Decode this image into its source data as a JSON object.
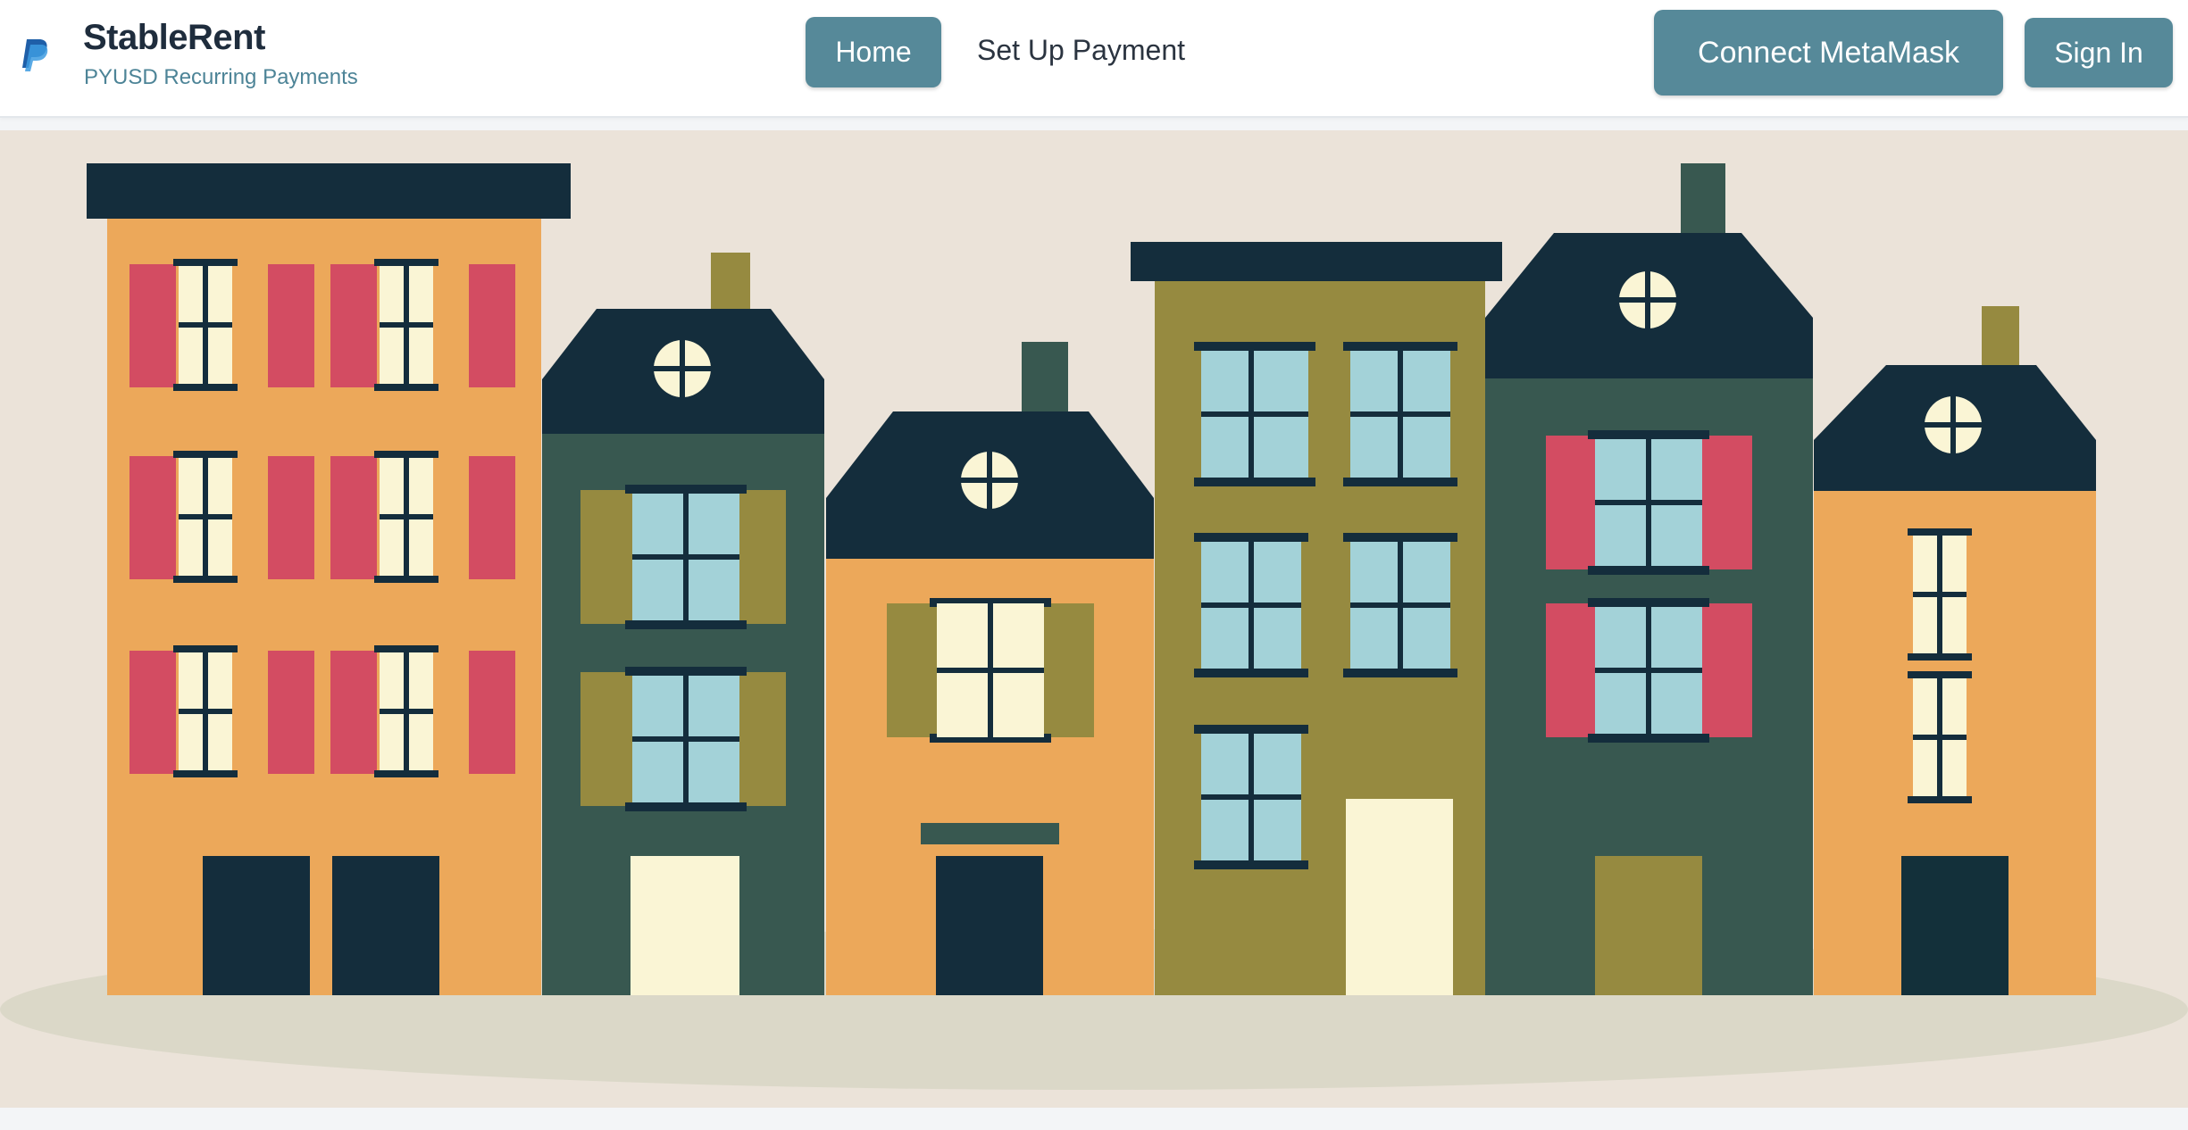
{
  "brand": {
    "title": "StableRent",
    "subtitle": "PYUSD Recurring Payments",
    "logo_icon": "paypal-logo-icon"
  },
  "nav": {
    "home_label": "Home",
    "setup_payment_label": "Set Up Payment"
  },
  "actions": {
    "connect_label": "Connect MetaMask",
    "signin_label": "Sign In"
  },
  "hero": {
    "image": "townhouses-illustration"
  },
  "colors": {
    "accent": "#568999",
    "brand_text": "#1f2d3d",
    "subtitle": "#4d8497",
    "hero_bg": "#ebe3d9"
  }
}
